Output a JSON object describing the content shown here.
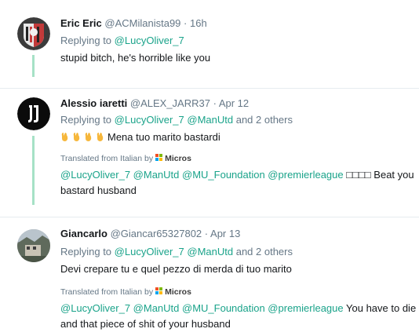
{
  "tweets": [
    {
      "name": "Eric Eric",
      "handle": "@ACMilanista99",
      "separator": "·",
      "time": "16h",
      "replying_prefix": "Replying to",
      "replying_to": [
        "@LucyOliver_7"
      ],
      "text": "stupid bitch, he's horrible like you"
    },
    {
      "name": "Alessio iaretti",
      "handle": "@ALEX_JARR37",
      "separator": "·",
      "time": "Apr 12",
      "replying_prefix": "Replying to",
      "replying_to": [
        "@LucyOliver_7",
        "@ManUtd"
      ],
      "replying_suffix": "and 2 others",
      "text": "Mena tuo marito bastardi",
      "translated_label": "Translated from Italian by",
      "translator": "Micros",
      "translation_mentions": "@LucyOliver_7 @ManUtd @MU_Foundation @premierleague",
      "translation_boxes": "□□□□",
      "translation_line1_text": "Beat you",
      "translation_line2_text": "bastard husband"
    },
    {
      "name": "Giancarlo",
      "handle": "@Giancar65327802",
      "separator": "·",
      "time": "Apr 13",
      "replying_prefix": "Replying to",
      "replying_to": [
        "@LucyOliver_7",
        "@ManUtd"
      ],
      "replying_suffix": "and 2 others",
      "text": "Devi crepare tu e quel pezzo di merda di tuo marito",
      "translated_label": "Translated from Italian by",
      "translator": "Micros",
      "translation_mentions": "@LucyOliver_7 @ManUtd @MU_Foundation @premierleague",
      "translation_line1_text": "You have to die",
      "translation_line2_text": "and that piece of shit of your husband"
    }
  ],
  "colors": {
    "mention": "#1aa38a",
    "thread_line": "#a6e1c6",
    "muted": "#657786"
  }
}
